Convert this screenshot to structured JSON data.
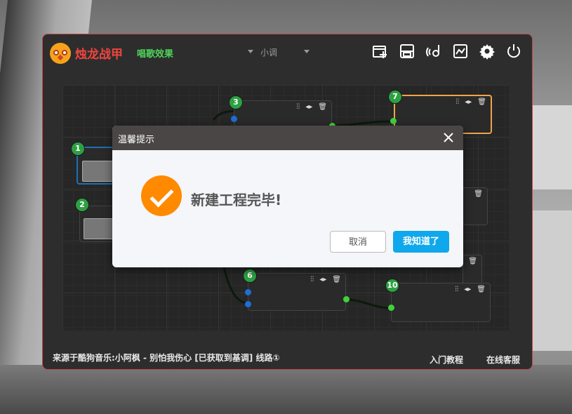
{
  "app": {
    "title": "烛龙战甲",
    "subtitle": "唱歌效果",
    "key_select": "小调"
  },
  "toolbar": {
    "icons": [
      "new-project-icon",
      "save-icon",
      "sound-icon",
      "adjust-icon",
      "settings-icon",
      "power-icon"
    ]
  },
  "nodes": [
    {
      "id": "1"
    },
    {
      "id": "2"
    },
    {
      "id": "3"
    },
    {
      "id": "6"
    },
    {
      "id": "7"
    },
    {
      "id": "10"
    }
  ],
  "node_controls": {
    "filter": "⫶⫶",
    "curve": "◂▸"
  },
  "footer": {
    "source": "来源于酷狗音乐:小阿枫 - 别怕我伤心 [已获取到基调] 线路①",
    "tutorial": "入门教程",
    "support": "在线客服"
  },
  "modal": {
    "title": "温馨提示",
    "message": "新建工程完毕!",
    "cancel_label": "取消",
    "ok_label": "我知道了"
  },
  "colors": {
    "accent_red": "#f0453f",
    "accent_green": "#4fd25a",
    "ok_button": "#0fa8ec",
    "success_icon": "#ff8a00"
  }
}
